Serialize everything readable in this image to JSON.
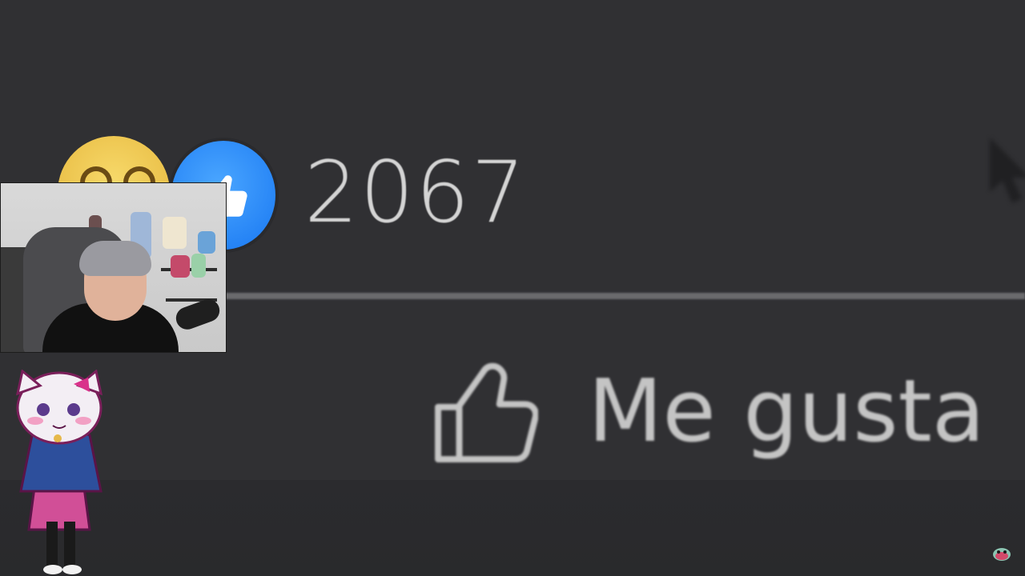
{
  "reactions": {
    "count": "2067",
    "icons": [
      "haha-emoji-icon",
      "like-reaction-icon"
    ]
  },
  "actions": {
    "like_label": "Me gusta",
    "like_icon": "thumbs-up-outline-icon"
  },
  "colors": {
    "background": "#303033",
    "like_blue": "#1877f2",
    "haha_yellow": "#f2cd55",
    "text": "#d4d4d4"
  },
  "overlays": {
    "webcam": "streamer-webcam",
    "avatar": "vtuber-avatar",
    "watermark": "channel-watermark-icon"
  }
}
